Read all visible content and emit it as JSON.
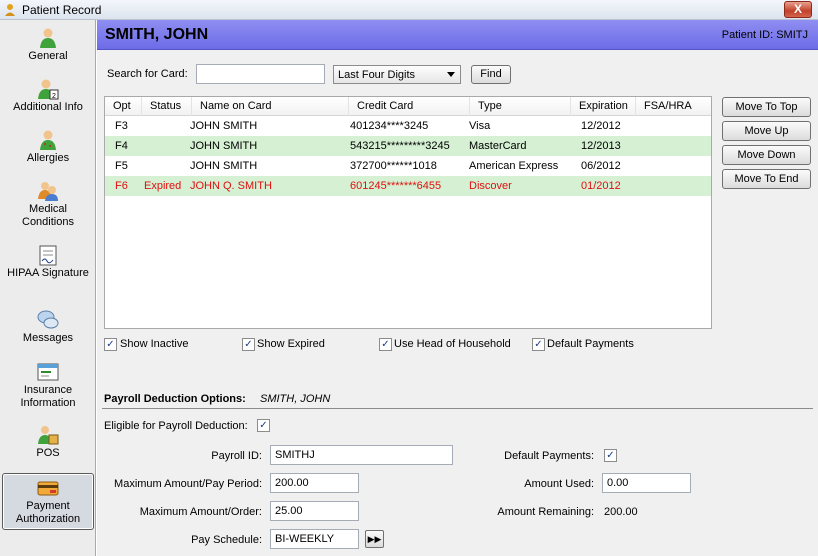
{
  "window": {
    "title": "Patient Record",
    "close_glyph": "X"
  },
  "sidebar": {
    "items": [
      {
        "label": "General",
        "icon": "person-green-icon"
      },
      {
        "label": "Additional Info",
        "icon": "person-info-icon"
      },
      {
        "label": "Allergies",
        "icon": "person-allergy-icon"
      },
      {
        "label": "Medical Conditions",
        "icon": "medical-conditions-icon"
      },
      {
        "label": "HIPAA Signature",
        "icon": "signature-icon"
      },
      {
        "label": "Messages",
        "icon": "messages-icon"
      },
      {
        "label": "Insurance Information",
        "icon": "insurance-icon"
      },
      {
        "label": "POS",
        "icon": "pos-icon"
      },
      {
        "label": "Payment Authorization",
        "icon": "credit-card-icon",
        "selected": true
      }
    ]
  },
  "header": {
    "patient_name": "SMITH, JOHN",
    "patient_id": "Patient ID: SMITJ"
  },
  "search": {
    "label": "Search for Card:",
    "value": "",
    "mode": "Last Four Digits",
    "find_label": "Find"
  },
  "grid": {
    "columns": [
      "Opt",
      "Status",
      "Name on Card",
      "Credit Card",
      "Type",
      "Expiration",
      "FSA/HRA"
    ],
    "rows": [
      {
        "opt": "F3",
        "status": "",
        "name": "JOHN SMITH",
        "card": "401234****3245",
        "type": "Visa",
        "exp": "12/2012",
        "fsa": ""
      },
      {
        "opt": "F4",
        "status": "",
        "name": "JOHN SMITH",
        "card": "543215*********3245",
        "type": "MasterCard",
        "exp": "12/2013",
        "fsa": ""
      },
      {
        "opt": "F5",
        "status": "",
        "name": "JOHN SMITH",
        "card": "372700******1018",
        "type": "American Express",
        "exp": "06/2012",
        "fsa": ""
      },
      {
        "opt": "F6",
        "status": "Expired",
        "name": "JOHN Q. SMITH",
        "card": "601245*******6455",
        "type": "Discover",
        "exp": "01/2012",
        "fsa": ""
      }
    ]
  },
  "side_buttons": {
    "move_to_top": "Move To Top",
    "move_up": "Move Up",
    "move_down": "Move Down",
    "move_to_end": "Move To End"
  },
  "filters": {
    "show_inactive": {
      "label": "Show Inactive",
      "checked": true
    },
    "show_expired": {
      "label": "Show Expired",
      "checked": true
    },
    "use_head_of_household": {
      "label": "Use Head of Household",
      "checked": true
    },
    "default_payments": {
      "label": "Default Payments",
      "checked": true
    }
  },
  "payroll": {
    "title": "Payroll Deduction Options:",
    "subtitle": "SMITH, JOHN",
    "eligible_label": "Eligible for Payroll Deduction:",
    "eligible_checked": true,
    "payroll_id_label": "Payroll ID:",
    "payroll_id": "SMITHJ",
    "max_period_label": "Maximum Amount/Pay Period:",
    "max_period": "200.00",
    "max_order_label": "Maximum Amount/Order:",
    "max_order": "25.00",
    "schedule_label": "Pay Schedule:",
    "schedule": "BI-WEEKLY",
    "schedule_button": "▶▶",
    "default_payments_label": "Default Payments:",
    "default_payments_checked": true,
    "amount_used_label": "Amount Used:",
    "amount_used": "0.00",
    "amount_remaining_label": "Amount Remaining:",
    "amount_remaining": "200.00"
  },
  "check_glyph": "✓"
}
